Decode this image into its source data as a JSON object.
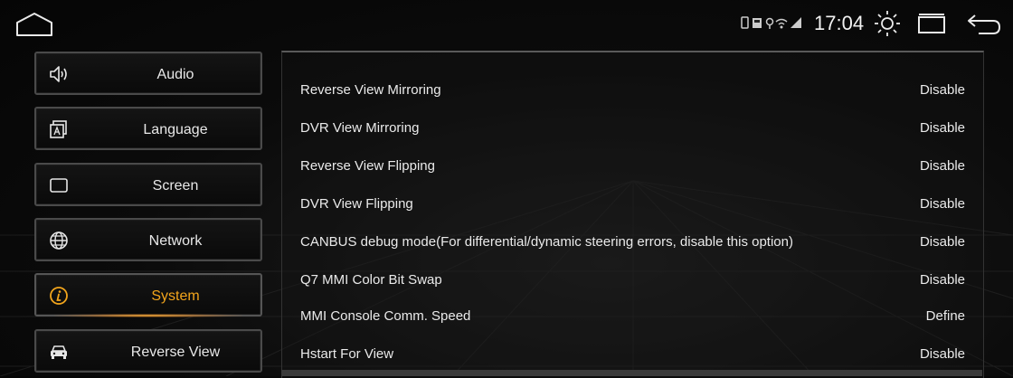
{
  "status_bar": {
    "time": "17:04",
    "icons": [
      "home-icon",
      "usb-icon",
      "sd-card-icon",
      "location-icon",
      "wifi-icon",
      "signal-icon",
      "brightness-icon",
      "windows-icon",
      "back-icon"
    ]
  },
  "sidebar": {
    "items": [
      {
        "label": "Audio",
        "icon": "speaker-icon"
      },
      {
        "label": "Language",
        "icon": "language-icon"
      },
      {
        "label": "Screen",
        "icon": "screen-icon"
      },
      {
        "label": "Network",
        "icon": "globe-icon"
      },
      {
        "label": "System",
        "icon": "info-icon",
        "active": true
      },
      {
        "label": "Reverse View",
        "icon": "car-icon"
      }
    ],
    "active_color": "#f2a51c"
  },
  "settings": {
    "rows": [
      {
        "label": "Reverse View Mirroring",
        "value": "Disable"
      },
      {
        "label": "DVR View Mirroring",
        "value": "Disable"
      },
      {
        "label": "Reverse View Flipping",
        "value": "Disable"
      },
      {
        "label": "DVR View Flipping",
        "value": "Disable"
      },
      {
        "label": "CANBUS debug mode(For differential/dynamic steering errors, disable this option)",
        "value": "Disable"
      },
      {
        "label": "Q7 MMI Color Bit Swap",
        "value": "Disable"
      },
      {
        "label": "MMI Console Comm. Speed",
        "value": "Define"
      },
      {
        "label": "Hstart For View",
        "value": "Disable"
      }
    ]
  }
}
